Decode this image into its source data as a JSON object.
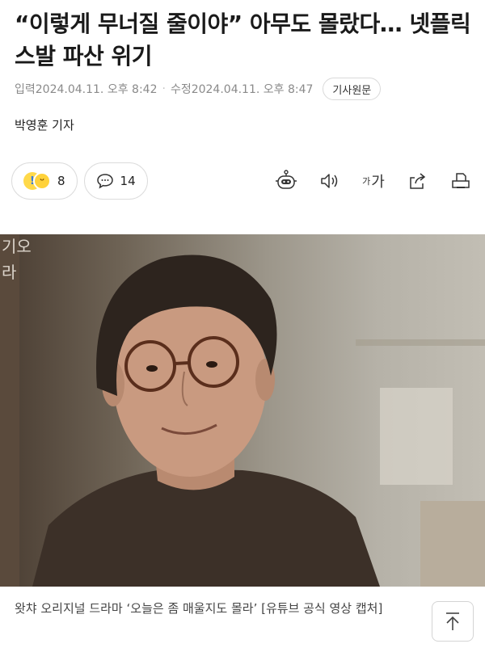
{
  "article": {
    "headline": "“이렇게 무너질 줄이야” 아무도 몰랐다… 넷플릭스발 파산 위기",
    "input_label": "입력",
    "input_date": "2024.04.11. 오후 8:42",
    "edit_label": "수정",
    "edit_date": "2024.04.11. 오후 8:47",
    "original_button": "기사원문",
    "reporter": "박영훈 기자"
  },
  "reactions": {
    "count": "8",
    "comments": "14"
  },
  "toolbar": {
    "font_small": "가",
    "font_large": "가"
  },
  "photo": {
    "overlay_text": "기오 라",
    "caption": "왓챠 오리지널 드라마 ‘오늘은 좀 매울지도 몰라’ [유튜브 공식 영상 캡처]"
  },
  "colors": {
    "meta_text": "#8a8a8a",
    "border": "#dcdcdc",
    "shirt": "#3c3028"
  }
}
